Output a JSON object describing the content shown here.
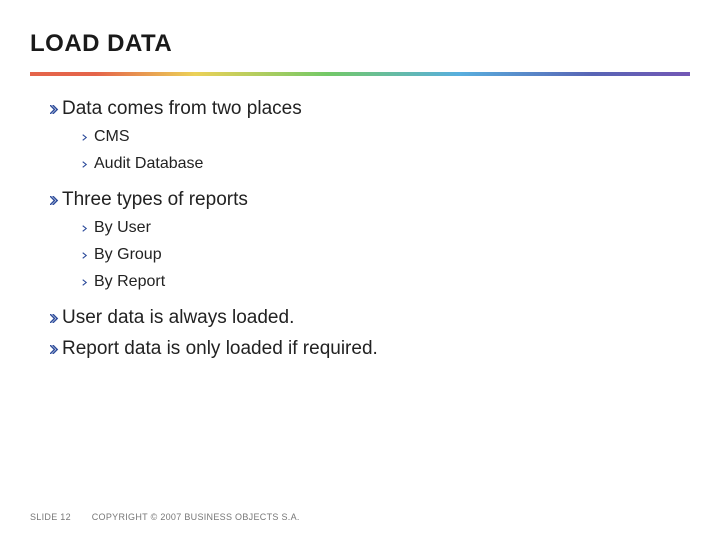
{
  "title": "LOAD DATA",
  "bullets": {
    "b1_0": "Data comes from two places",
    "b1_0_sub": [
      "CMS",
      "Audit Database"
    ],
    "b1_1": "Three types of reports",
    "b1_1_sub": [
      "By User",
      "By Group",
      "By Report"
    ],
    "b1_2": "User data is always loaded.",
    "b1_3": "Report data is only loaded if required."
  },
  "footer": {
    "slide": "SLIDE 12",
    "copyright": "COPYRIGHT © 2007 BUSINESS OBJECTS S.A."
  }
}
